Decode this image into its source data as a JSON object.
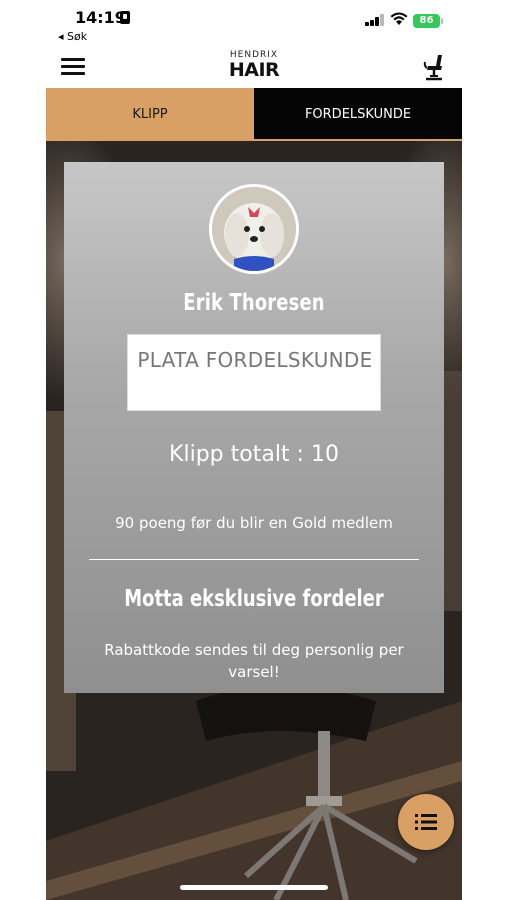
{
  "status_bar": {
    "time": "14:19",
    "back_label": "◂ Søk",
    "battery": "86"
  },
  "header": {
    "logo_top": "HENDRIX",
    "logo_main": "HAIR",
    "menu_icon": "hamburger-icon",
    "chair_icon": "barber-chair-icon"
  },
  "tabs": [
    {
      "label": "KLIPP",
      "active": true
    },
    {
      "label": "FORDELSKUNDE",
      "active": false
    }
  ],
  "card": {
    "name": "Erik Thoresen",
    "level": "PLATA FORDELSKUNDE",
    "total": "Klipp totalt : 10",
    "points_info": "90 poeng før du blir en Gold medlem",
    "benefits_title": "Motta eksklusive fordeler",
    "benefits_text": "Rabattkode sendes til deg personlig per varsel!"
  },
  "fab": {
    "icon": "list-icon"
  },
  "colors": {
    "accent": "#d9a066",
    "dark": "#050505",
    "card": "#a9a9a9"
  }
}
